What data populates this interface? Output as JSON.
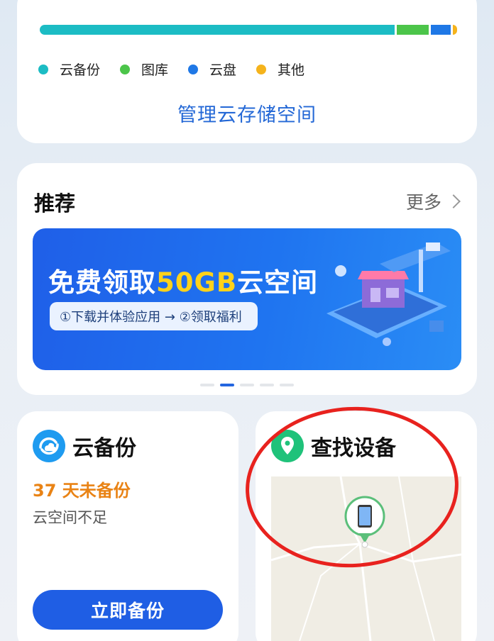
{
  "storage": {
    "bar_colors": {
      "backup": "#1cbcc4",
      "gallery": "#4cc54a",
      "drive": "#1f78e6",
      "other": "#f5b31c"
    },
    "legend": [
      {
        "label": "云备份",
        "color": "#1cbcc4"
      },
      {
        "label": "图库",
        "color": "#4cc54a"
      },
      {
        "label": "云盘",
        "color": "#1f78e6"
      },
      {
        "label": "其他",
        "color": "#f5b31c"
      }
    ],
    "manage_label": "管理云存储空间"
  },
  "recommend": {
    "title": "推荐",
    "more_label": "更多",
    "banner": {
      "title_prefix": "免费领取",
      "title_highlight": "50GB",
      "title_suffix": "云空间",
      "steps": "①下载并体验应用 → ②领取福利"
    },
    "carousel_count": 5,
    "carousel_active": 2
  },
  "backup": {
    "title": "云备份",
    "status": "37 天未备份",
    "subtitle": "云空间不足",
    "button_label": "立即备份"
  },
  "find_device": {
    "title": "查找设备",
    "accent": "#1fc27a"
  },
  "annotation_color": "#e8221e"
}
